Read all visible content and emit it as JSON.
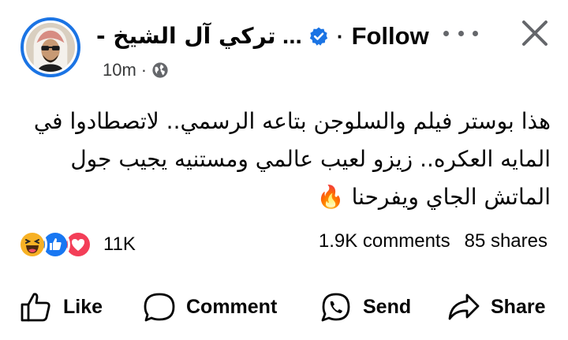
{
  "post": {
    "author_suffix": "- تركي آل الشيخ",
    "ellipsis": "...",
    "separator": "·",
    "follow_label": "Follow",
    "timestamp": "10m",
    "meta_separator": "·",
    "text_lines": [
      "هذا بوستر فيلم والسلوجن بتاعه الرسمي.. لاتصطادوا في",
      "المايه العكره.. زيزو لعيب عالمي ومستنيه يجيب جول",
      "الماتش الجاي ويفرحنا 🔥"
    ],
    "reaction_count": "11K",
    "comments_count": "1.9K comments",
    "shares_count": "85 shares",
    "reactions": [
      "haha-icon",
      "like-icon",
      "love-icon"
    ]
  },
  "actions": {
    "like_label": "Like",
    "comment_label": "Comment",
    "send_label": "Send",
    "share_label": "Share"
  },
  "colors": {
    "verified_blue": "#1b74e4",
    "avatar_ring": "#1b74e4",
    "like_blue": "#1877f2",
    "love_red": "#f33e58",
    "haha_yellow": "#f7b125"
  }
}
